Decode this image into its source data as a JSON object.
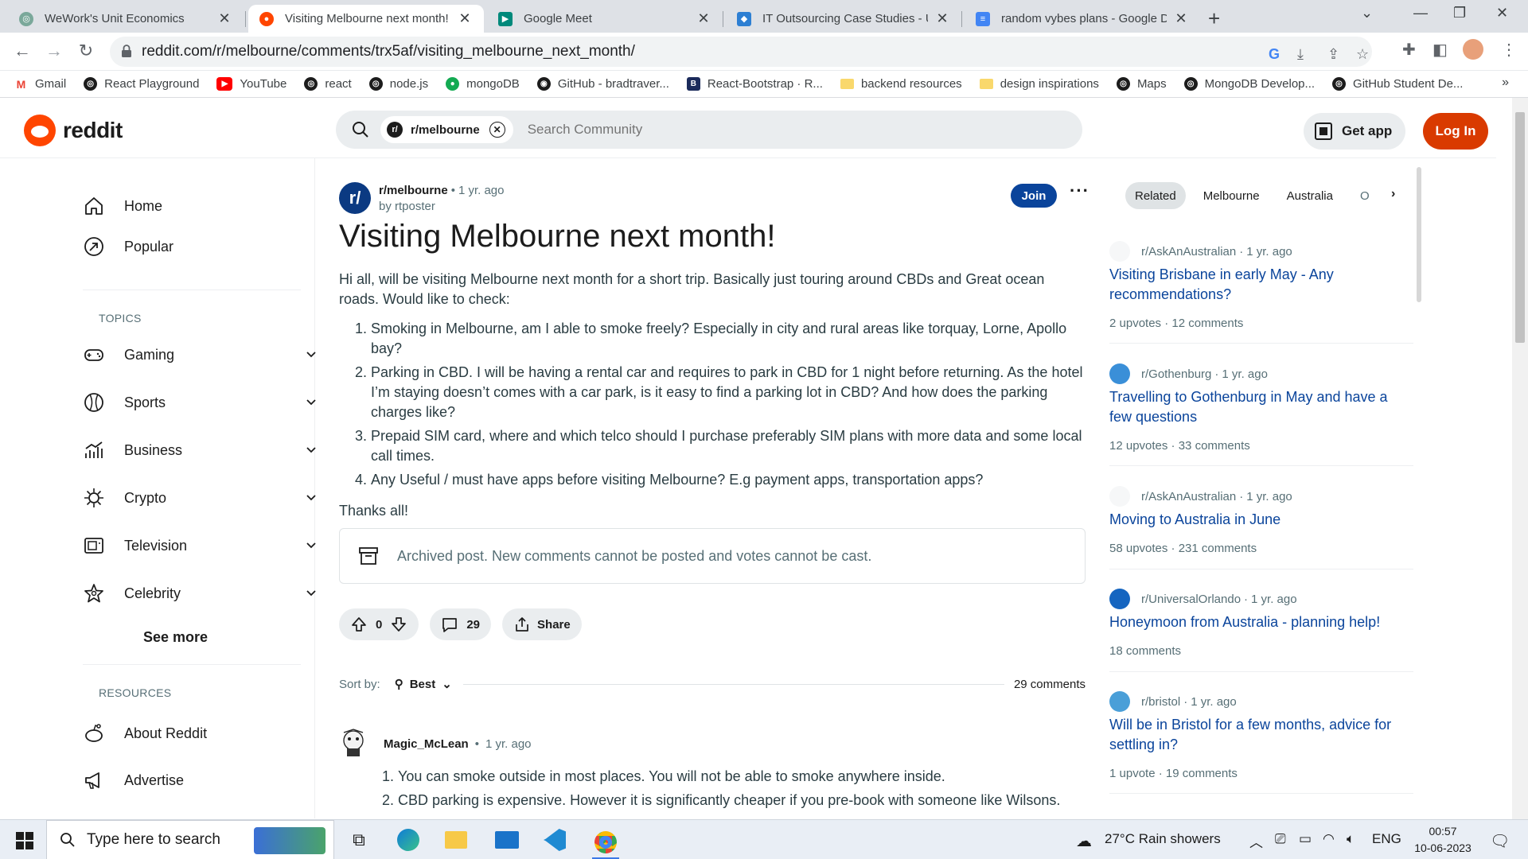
{
  "browser": {
    "tabs": [
      {
        "title": "WeWork's Unit Economics",
        "color": "#7aa89a"
      },
      {
        "title": "Visiting Melbourne next month!",
        "color": "#ff4500"
      },
      {
        "title": "Google Meet",
        "color": "#00897b"
      },
      {
        "title": "IT Outsourcing Case Studies - US",
        "color": "#2d7fd3"
      },
      {
        "title": "random vybes plans - Google Do",
        "color": "#4285f4"
      }
    ],
    "url": "reddit.com/r/melbourne/comments/trx5af/visiting_melbourne_next_month/",
    "bookmarks": [
      {
        "label": "Gmail",
        "type": "icon",
        "color": "#ea4335",
        "glyph": "M"
      },
      {
        "label": "React Playground",
        "type": "icon",
        "color": "#1c1c1c",
        "glyph": "◎"
      },
      {
        "label": "YouTube",
        "type": "icon",
        "color": "#ff0000",
        "glyph": "▶"
      },
      {
        "label": "react",
        "type": "icon",
        "color": "#1c1c1c",
        "glyph": "◎"
      },
      {
        "label": "node.js",
        "type": "icon",
        "color": "#1c1c1c",
        "glyph": "◎"
      },
      {
        "label": "mongoDB",
        "type": "icon",
        "color": "#13aa52",
        "glyph": "●"
      },
      {
        "label": "GitHub - bradtraver...",
        "type": "icon",
        "color": "#1c1c1c",
        "glyph": "◉"
      },
      {
        "label": "React-Bootstrap · R...",
        "type": "icon",
        "color": "#563d7c",
        "glyph": "B"
      },
      {
        "label": "backend resources",
        "type": "folder"
      },
      {
        "label": "design inspirations",
        "type": "folder"
      },
      {
        "label": "Maps",
        "type": "icon",
        "color": "#1c1c1c",
        "glyph": "◎"
      },
      {
        "label": "MongoDB Develop...",
        "type": "icon",
        "color": "#1c1c1c",
        "glyph": "◎"
      },
      {
        "label": "GitHub Student De...",
        "type": "icon",
        "color": "#1c1c1c",
        "glyph": "◎"
      }
    ]
  },
  "header": {
    "logo_text": "reddit",
    "search_chip": "r/melbourne",
    "search_placeholder": "Search Community",
    "get_app": "Get app",
    "login": "Log In"
  },
  "sidebar": {
    "home": "Home",
    "popular": "Popular",
    "topics_heading": "TOPICS",
    "topics": [
      "Gaming",
      "Sports",
      "Business",
      "Crypto",
      "Television",
      "Celebrity"
    ],
    "see_more": "See more",
    "resources_heading": "RESOURCES",
    "resources": [
      "About Reddit",
      "Advertise"
    ]
  },
  "post": {
    "subreddit": "r/melbourne",
    "age": "1 yr. ago",
    "author": "by rtposter",
    "join": "Join",
    "title": "Visiting Melbourne next month!",
    "intro": "Hi all, will be visiting Melbourne next month for a short trip. Basically just touring around CBDs and Great ocean roads. Would like to check:",
    "items": [
      "Smoking in Melbourne, am I able to smoke freely? Especially in city and rural areas like torquay, Lorne, Apollo bay?",
      "Parking in CBD. I will be having a rental car and requires to park in CBD for 1 night before returning. As the hotel I’m staying doesn’t comes with a car park, is it easy to find a parking lot in CBD? And how does the parking charges like?",
      "Prepaid SIM card, where and which telco should I purchase preferably SIM plans with more data and some local call times.",
      "Any Useful / must have apps before visiting Melbourne? E.g payment apps, transportation apps?"
    ],
    "thanks": "Thanks all!",
    "archived": "Archived post. New comments cannot be posted and votes cannot be cast.",
    "votes": "0",
    "comments": "29",
    "share": "Share",
    "sort_label": "Sort by:",
    "sort_value": "Best",
    "comment_count": "29 comments"
  },
  "comment": {
    "user": "Magic_McLean",
    "age": "1 yr. ago",
    "lines": [
      "You can smoke outside in most places. You will not be able to smoke anywhere inside.",
      "CBD parking is expensive. However it is significantly cheaper if you pre-book with someone like Wilsons."
    ]
  },
  "rail": {
    "tabs": [
      "Related",
      "Melbourne",
      "Australia",
      "O"
    ],
    "items": [
      {
        "sub": "r/AskAnAustralian",
        "age": "1 yr. ago",
        "title": "Visiting Brisbane in early May - Any recommendations?",
        "stats": "2 upvotes · 12 comments",
        "icon_color": "#f6f7f8"
      },
      {
        "sub": "r/Gothenburg",
        "age": "1 yr. ago",
        "title": "Travelling to Gothenburg in May and have a few questions",
        "stats": "12 upvotes · 33 comments",
        "icon_color": "#3a8fd8"
      },
      {
        "sub": "r/AskAnAustralian",
        "age": "1 yr. ago",
        "title": "Moving to Australia in June",
        "stats": "58 upvotes · 231 comments",
        "icon_color": "#f6f7f8"
      },
      {
        "sub": "r/UniversalOrlando",
        "age": "1 yr. ago",
        "title": "Honeymoon from Australia - planning help!",
        "stats": "18 comments",
        "icon_color": "#1565c0"
      },
      {
        "sub": "r/bristol",
        "age": "1 yr. ago",
        "title": "Will be in Bristol for a few months, advice for settling in?",
        "stats": "1 upvote · 19 comments",
        "icon_color": "#4a9fd8"
      }
    ]
  },
  "taskbar": {
    "search_placeholder": "Type here to search",
    "weather": "27°C  Rain showers",
    "lang": "ENG",
    "time": "00:57",
    "date": "10-06-2023"
  }
}
